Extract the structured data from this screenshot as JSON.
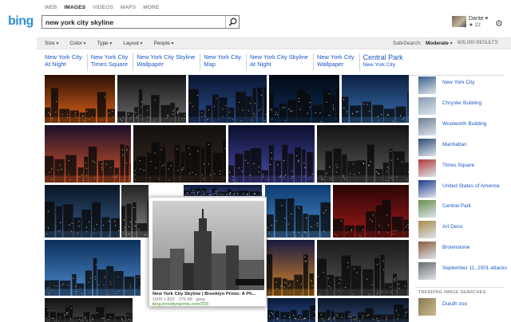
{
  "nav": [
    "WEB",
    "IMAGES",
    "VIDEOS",
    "MAPS",
    "MORE"
  ],
  "logo": {
    "text": "bing"
  },
  "search": {
    "query": "new york city skyline"
  },
  "user": {
    "name": "Dante ▾",
    "points": "★ 22"
  },
  "filters": [
    "Size",
    "Color",
    "Type",
    "Layout",
    "People"
  ],
  "safesearch": {
    "label": "SafeSearch:",
    "value": "Moderate"
  },
  "results_count": "605,000 RESULTS",
  "related": [
    {
      "line1": "New York City",
      "line2": "At Night"
    },
    {
      "line1": "New York City",
      "line2": "Times Square"
    },
    {
      "line1": "New York City Skyline",
      "line2": "Wallpaper"
    },
    {
      "line1": "New York City",
      "line2": "Map"
    },
    {
      "line1": "New York City Skyline",
      "line2": "At Night"
    },
    {
      "line1": "New York City",
      "line2": "Wallpaper"
    },
    {
      "line1": "Central Park",
      "line2": "New York City"
    }
  ],
  "hover": {
    "title": "New York City Skyline | Brooklyn Prints: A Ph...",
    "meta": "1000 x 833 · 376 kB · jpeg",
    "url": "blog.brooklynprints.com/203"
  },
  "sidebar": [
    "New York City",
    "Chrysler Building",
    "Woolworth Building",
    "Manhattan",
    "Times Square",
    "United States of America",
    "Central Park",
    "Art Deco",
    "Brownstone",
    "September 11, 2001 attacks"
  ],
  "trending": {
    "heading": "TRENDING IMAGE SEARCHES",
    "first": "Duluth zoo"
  },
  "colors": {
    "link": "#1a57c5",
    "logo": "#2b8fd6",
    "url_green": "#3a8a22",
    "filterbar": "#eeeeee"
  }
}
